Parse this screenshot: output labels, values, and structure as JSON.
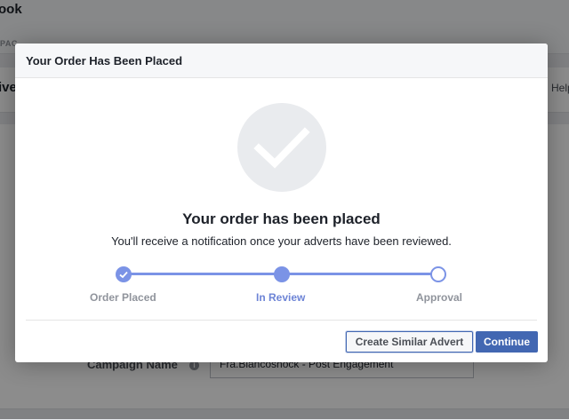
{
  "background": {
    "title": "ook",
    "subtitle": "PAC",
    "row_text": "ive",
    "help_link": "Help",
    "campaign_label": "Campaign Name",
    "info_icon": "info-icon",
    "campaign_value": "Fra.Biancoshock - Post Engagement"
  },
  "modal": {
    "title": "Your Order Has Been Placed",
    "status_icon": "checkmark-icon",
    "heading": "Your order has been placed",
    "message": "You'll receive a notification once your adverts have been reviewed.",
    "steps": [
      {
        "label": "Order Placed",
        "state": "done"
      },
      {
        "label": "In Review",
        "state": "current"
      },
      {
        "label": "Approval",
        "state": "pending"
      }
    ],
    "buttons": {
      "secondary": "Create Similar Advert",
      "primary": "Continue"
    }
  },
  "colors": {
    "accent": "#7b93e6",
    "primary_button": "#4267b2",
    "overlay": "#808080"
  }
}
